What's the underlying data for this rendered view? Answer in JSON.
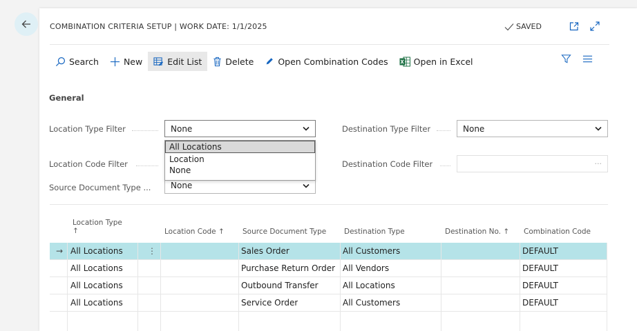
{
  "header": {
    "title": "COMBINATION CRITERIA SETUP | WORK DATE: 1/1/2025",
    "saved_label": "SAVED"
  },
  "toolbar": {
    "search": "Search",
    "new": "New",
    "edit_list": "Edit List",
    "delete": "Delete",
    "open_combination_codes": "Open Combination Codes",
    "open_in_excel": "Open in Excel"
  },
  "general": {
    "section_title": "General",
    "location_type_filter": {
      "label": "Location Type Filter",
      "value": "None"
    },
    "location_code_filter": {
      "label": "Location Code Filter",
      "value": ""
    },
    "source_document_type": {
      "label": "Source Document Type ...",
      "value": "None"
    },
    "destination_type_filter": {
      "label": "Destination Type Filter",
      "value": "None"
    },
    "destination_code_filter": {
      "label": "Destination Code Filter",
      "value": "",
      "ellipsis": "···"
    }
  },
  "dropdown": {
    "options": [
      "All Locations",
      "Location",
      "None"
    ],
    "highlighted": "All Locations"
  },
  "table": {
    "headers": {
      "location_type": "Location Type",
      "location_type_sort": "↑",
      "location_code": "Location Code ↑",
      "source_document_type": "Source Document Type",
      "destination_type": "Destination Type",
      "destination_no": "Destination No. ↑",
      "combination_code": "Combination Code"
    },
    "rows": [
      {
        "location_type": "All Locations",
        "location_code": "",
        "source_document_type": "Sales Order",
        "destination_type": "All Customers",
        "destination_no": "",
        "combination_code": "DEFAULT"
      },
      {
        "location_type": "All Locations",
        "location_code": "",
        "source_document_type": "Purchase Return Order",
        "destination_type": "All Vendors",
        "destination_no": "",
        "combination_code": "DEFAULT"
      },
      {
        "location_type": "All Locations",
        "location_code": "",
        "source_document_type": "Outbound Transfer",
        "destination_type": "All Locations",
        "destination_no": "",
        "combination_code": "DEFAULT"
      },
      {
        "location_type": "All Locations",
        "location_code": "",
        "source_document_type": "Service Order",
        "destination_type": "All Customers",
        "destination_no": "",
        "combination_code": "DEFAULT"
      },
      {
        "location_type": "",
        "location_code": "",
        "source_document_type": "",
        "destination_type": "",
        "destination_no": "",
        "combination_code": ""
      }
    ],
    "row_indicator": "→",
    "row_menu": "⋮"
  },
  "colors": {
    "accent": "#0f6fc6",
    "selected_row": "#b5e3e8",
    "back_button": "#dff0f6",
    "excel_green": "#1e7145"
  }
}
